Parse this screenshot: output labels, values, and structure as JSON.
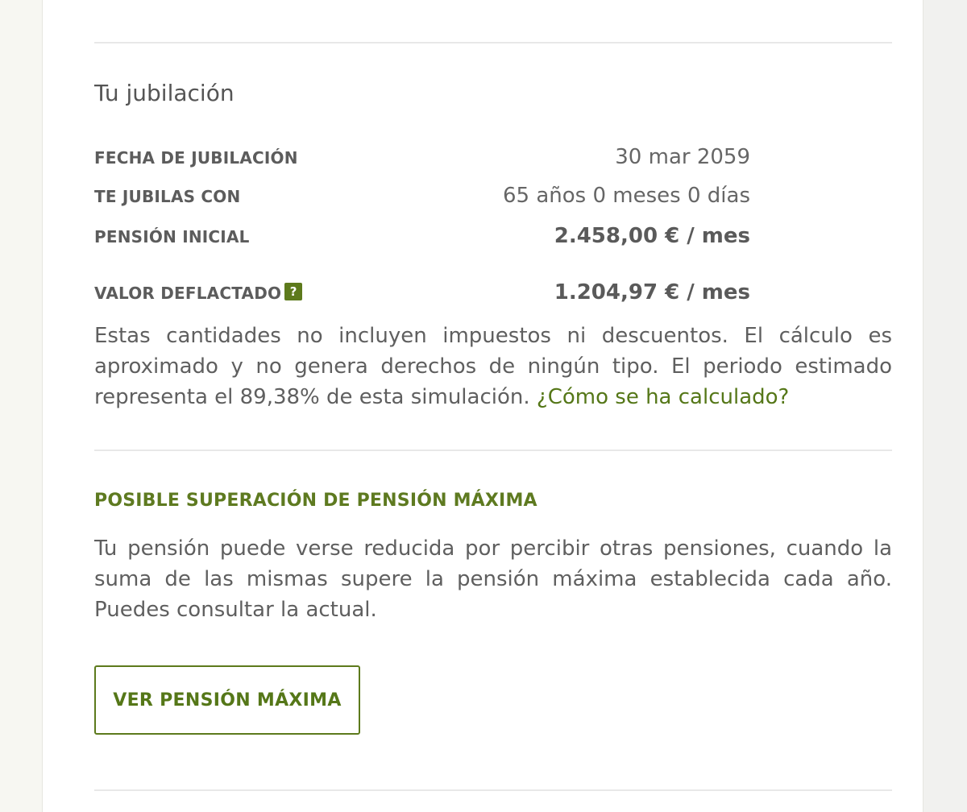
{
  "retirement": {
    "title": "Tu jubilación",
    "rows": [
      {
        "label": "FECHA DE JUBILACIÓN",
        "value": "30 mar 2059"
      },
      {
        "label": "TE JUBILAS CON",
        "value": "65 años 0 meses 0 días"
      },
      {
        "label": "PENSIÓN INICIAL",
        "value": "2.458,00 € / mes"
      },
      {
        "label": "VALOR DEFLACTADO",
        "value": "1.204,97 € / mes",
        "help_icon": "?"
      }
    ],
    "disclaimer": "Estas cantidades no incluyen impuestos ni descuentos. El cálculo es aproximado y no genera derechos de ningún tipo. El periodo estimado representa el 89,38% de esta simulación.",
    "calc_link": "¿Cómo se ha calculado?"
  },
  "max_pension": {
    "title": "POSIBLE SUPERACIÓN DE PENSIÓN MÁXIMA",
    "text": "Tu pensión puede verse reducida por percibir otras pensiones, cuando la suma de las mismas supere la pensión máxima establecida cada año. Puedes consultar la actual.",
    "button_label": "VER PENSIÓN MÁXIMA"
  },
  "colors": {
    "accent": "#5d7a1c",
    "text": "#5f5f5f",
    "divider": "#e8e8e8"
  }
}
